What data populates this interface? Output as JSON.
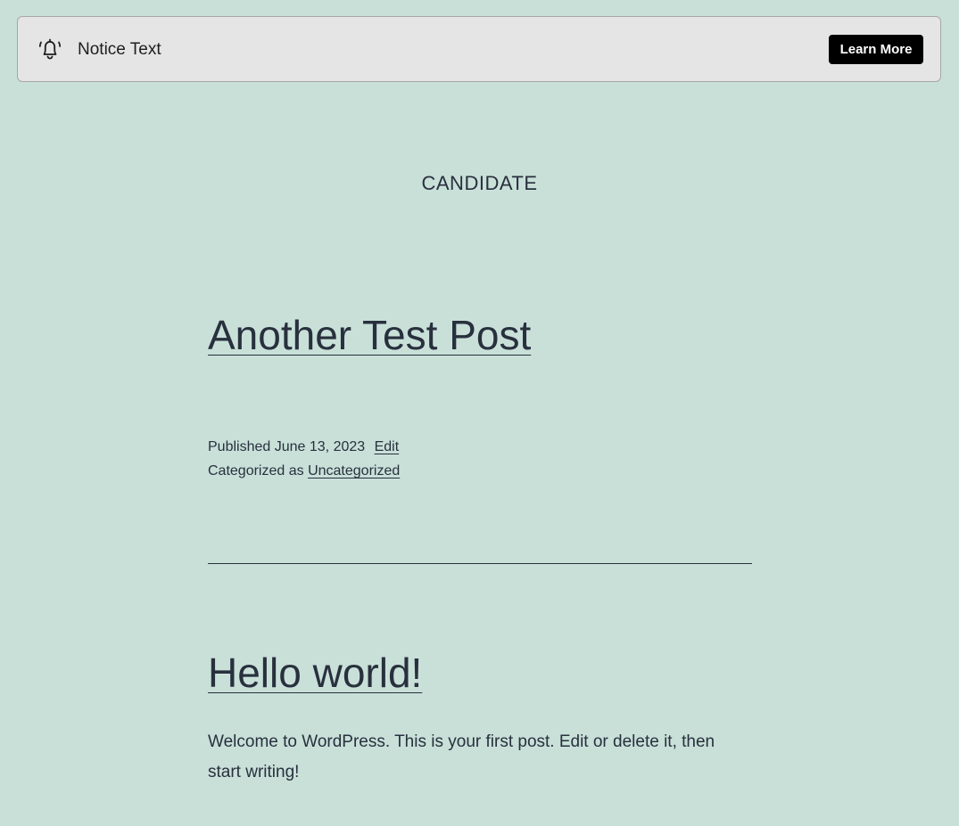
{
  "notice": {
    "icon": "bell-icon",
    "text": "Notice Text",
    "button_label": "Learn More"
  },
  "site": {
    "title": "CANDIDATE"
  },
  "posts": [
    {
      "title": "Another Test Post",
      "published_label": "Published",
      "date": "June 13, 2023",
      "edit_label": "Edit",
      "categorized_label": "Categorized as",
      "category": "Uncategorized"
    },
    {
      "title": "Hello world!",
      "excerpt": "Welcome to WordPress. This is your first post. Edit or delete it, then start writing!"
    }
  ],
  "colors": {
    "background": "#c9e0d9",
    "text": "#28303d",
    "notice_background": "#e5e5e5",
    "button_background": "#000000"
  }
}
